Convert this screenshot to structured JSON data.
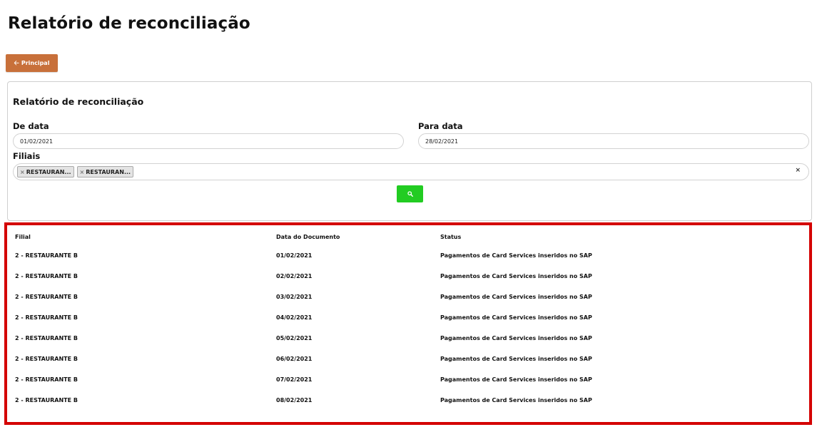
{
  "header": {
    "title": "Relatório de reconciliação"
  },
  "toolbar": {
    "back_label": "Principal"
  },
  "filter": {
    "title": "Relatório de reconciliação",
    "from_label": "De data",
    "from_value": "01/02/2021",
    "to_label": "Para data",
    "to_value": "28/02/2021",
    "branches_label": "Filiais",
    "selected_branches": [
      "RESTAURAN...",
      "RESTAURAN..."
    ],
    "clear_symbol": "×"
  },
  "table": {
    "columns": [
      "Filial",
      "Data do Documento",
      "Status"
    ],
    "rows": [
      [
        "2 - RESTAURANTE B",
        "01/02/2021",
        "Pagamentos de Card Services inseridos no SAP"
      ],
      [
        "2 - RESTAURANTE B",
        "02/02/2021",
        "Pagamentos de Card Services inseridos no SAP"
      ],
      [
        "2 - RESTAURANTE B",
        "03/02/2021",
        "Pagamentos de Card Services inseridos no SAP"
      ],
      [
        "2 - RESTAURANTE B",
        "04/02/2021",
        "Pagamentos de Card Services inseridos no SAP"
      ],
      [
        "2 - RESTAURANTE B",
        "05/02/2021",
        "Pagamentos de Card Services inseridos no SAP"
      ],
      [
        "2 - RESTAURANTE B",
        "06/02/2021",
        "Pagamentos de Card Services inseridos no SAP"
      ],
      [
        "2 - RESTAURANTE B",
        "07/02/2021",
        "Pagamentos de Card Services inseridos no SAP"
      ],
      [
        "2 - RESTAURANTE B",
        "08/02/2021",
        "Pagamentos de Card Services inseridos no SAP"
      ]
    ]
  },
  "colors": {
    "back_button": "#c8703a",
    "search_button": "#22cc22",
    "highlight_border": "#d40000"
  },
  "icons": {
    "back": "arrow-left-icon",
    "search": "search-icon",
    "chip_remove": "chip-remove-icon",
    "clear": "clear-icon"
  }
}
